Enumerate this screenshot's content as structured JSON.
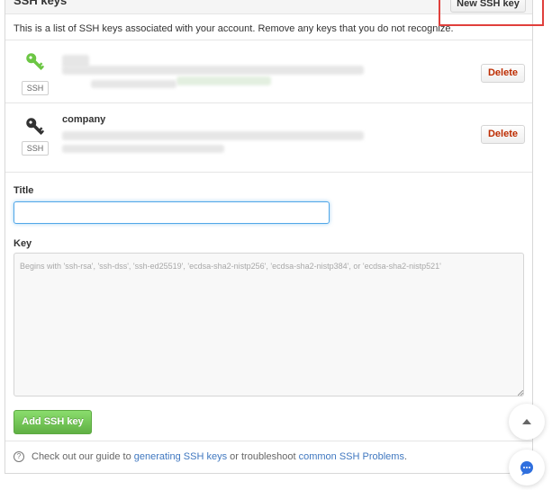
{
  "panel": {
    "title": "SSH keys",
    "new_key_label": "New SSH key",
    "intro": "This is a list of SSH keys associated with your account. Remove any keys that you do not recognize."
  },
  "keys": [
    {
      "name": "",
      "badge": "SSH",
      "delete_label": "Delete",
      "icon_color": "#6cc644"
    },
    {
      "name": "company",
      "badge": "SSH",
      "delete_label": "Delete",
      "icon_color": "#333333"
    }
  ],
  "form": {
    "title_label": "Title",
    "title_value": "",
    "key_label": "Key",
    "key_placeholder": "Begins with 'ssh-rsa', 'ssh-dss', 'ssh-ed25519', 'ecdsa-sha2-nistp256', 'ecdsa-sha2-nistp384', or 'ecdsa-sha2-nistp521'",
    "submit_label": "Add SSH key"
  },
  "footer": {
    "prefix": "Check out our guide to ",
    "link1": "generating SSH keys",
    "middle": " or troubleshoot ",
    "link2": "common SSH Problems",
    "suffix": "."
  },
  "icons": {
    "key": "key-icon",
    "help": "question-circle-icon",
    "scroll_top": "chevron-up-icon",
    "chat": "chat-bubble-icon"
  },
  "colors": {
    "highlight": "#e0403c",
    "add_button": "#60b044",
    "delete_text": "#bd2c00",
    "link": "#4078c0",
    "chat_accent": "#2f6fde"
  }
}
